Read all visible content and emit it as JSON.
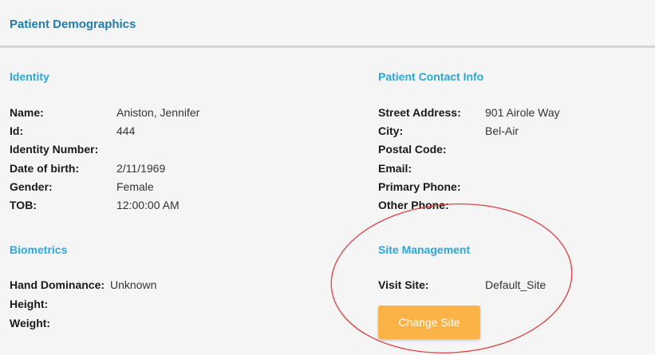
{
  "panel": {
    "title": "Patient Demographics"
  },
  "identity": {
    "heading": "Identity",
    "rows": [
      {
        "label": "Name:",
        "value": "Aniston, Jennifer"
      },
      {
        "label": "Id:",
        "value": "444"
      },
      {
        "label": "Identity Number:",
        "value": ""
      },
      {
        "label": "Date of birth:",
        "value": "2/11/1969"
      },
      {
        "label": "Gender:",
        "value": "Female"
      },
      {
        "label": "TOB:",
        "value": "12:00:00 AM"
      }
    ]
  },
  "contact": {
    "heading": "Patient Contact Info",
    "rows": [
      {
        "label": "Street Address:",
        "value": "901 Airole Way"
      },
      {
        "label": "City:",
        "value": "Bel-Air"
      },
      {
        "label": "Postal Code:",
        "value": ""
      },
      {
        "label": "Email:",
        "value": ""
      },
      {
        "label": "Primary Phone:",
        "value": ""
      },
      {
        "label": "Other Phone:",
        "value": ""
      }
    ]
  },
  "biometrics": {
    "heading": "Biometrics",
    "rows": [
      {
        "label": "Hand Dominance:",
        "value": "Unknown"
      },
      {
        "label": "Height:",
        "value": ""
      },
      {
        "label": "Weight:",
        "value": ""
      }
    ]
  },
  "site": {
    "heading": "Site Management",
    "visit_label": "Visit Site:",
    "visit_value": "Default_Site",
    "change_button": "Change Site"
  },
  "colors": {
    "section_heading": "#29a8e0",
    "panel_title": "#1f7cae",
    "button": "#fbb347",
    "annotation_ring": "#e04040"
  }
}
